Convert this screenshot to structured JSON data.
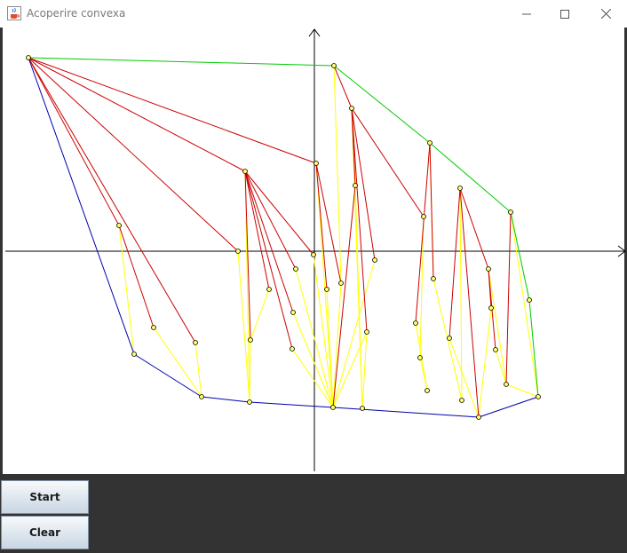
{
  "window": {
    "title": "Acoperire convexa",
    "controls": [
      "minimize",
      "maximize",
      "close"
    ]
  },
  "buttons": {
    "start_label": "Start",
    "clear_label": "Clear"
  },
  "colors": {
    "hull_upper": "#00cc00",
    "hull_lower": "#0000aa",
    "rejected_edges": "#cc0000",
    "candidate_edges": "#ffff00",
    "axes": "#000000",
    "point_fill": "#ffff66"
  },
  "icons": [
    "java-cup-icon",
    "minimize-icon",
    "maximize-icon",
    "close-icon"
  ]
}
